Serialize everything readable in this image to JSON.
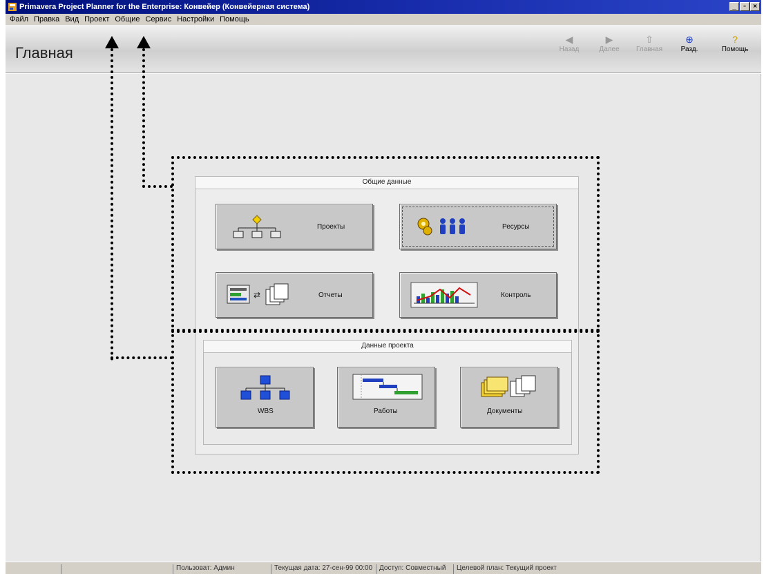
{
  "window": {
    "title": "Primavera Project Planner for the Enterprise: Конвейер (Конвейерная система)",
    "controls": [
      "_",
      "▫",
      "×"
    ]
  },
  "menu": [
    "Файл",
    "Правка",
    "Вид",
    "Проект",
    "Общие",
    "Сервис",
    "Настройки",
    "Помощь"
  ],
  "header": {
    "title": "Главная",
    "nav": [
      {
        "label": "Назад",
        "icon": "back-arrow-icon",
        "glyph": "◀"
      },
      {
        "label": "Далее",
        "icon": "forward-arrow-icon",
        "glyph": "▶"
      },
      {
        "label": "Главная",
        "icon": "home-icon",
        "glyph": "⇧"
      },
      {
        "label": "Разд.",
        "icon": "sections-icon",
        "glyph": "⊕"
      },
      {
        "label": "Помощь",
        "icon": "help-icon",
        "glyph": "?"
      }
    ]
  },
  "general_panel": {
    "title": "Общие данные",
    "buttons": {
      "projects": "Проекты",
      "resources": "Ресурсы",
      "reports": "Отчеты",
      "control": "Контроль"
    }
  },
  "project_panel": {
    "title": "Данные проекта",
    "buttons": {
      "wbs": "WBS",
      "activities": "Работы",
      "documents": "Документы"
    }
  },
  "status": {
    "user": "Пользоват: Админ",
    "date": "Текущая дата: 27-сен-99 00:00",
    "access": "Доступ: Совместный",
    "baseline": "Целевой план: Текущий проект"
  },
  "colors": {
    "title_bar": "#00107a",
    "button_face": "#c8c8c8",
    "content_bg": "#e8e8e8"
  }
}
